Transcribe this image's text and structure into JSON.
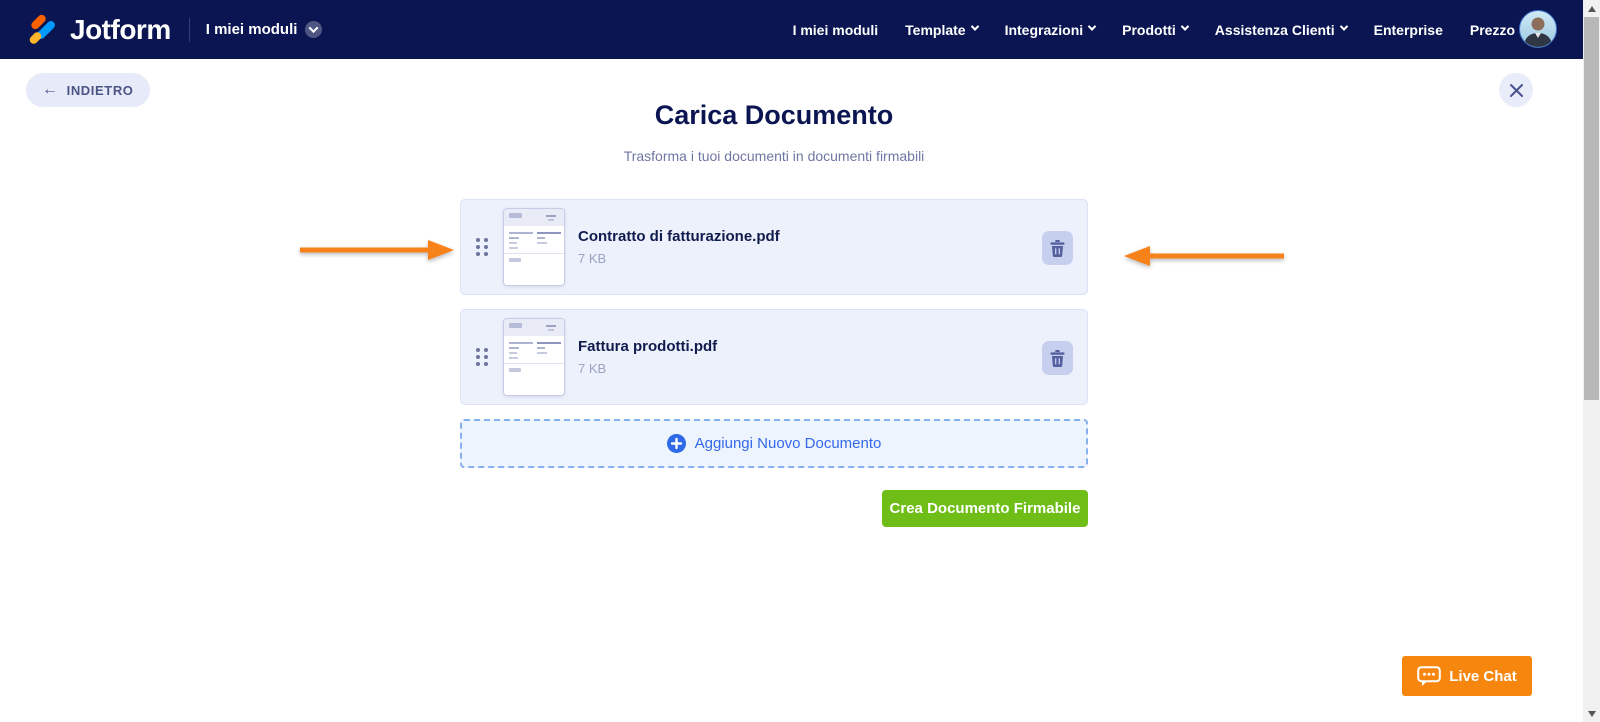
{
  "navbar": {
    "brand": "Jotform",
    "workspace_label": "I miei moduli",
    "links": [
      {
        "label": "I miei moduli",
        "dropdown": false
      },
      {
        "label": "Template",
        "dropdown": true
      },
      {
        "label": "Integrazioni",
        "dropdown": true
      },
      {
        "label": "Prodotti",
        "dropdown": true
      },
      {
        "label": "Assistenza Clienti",
        "dropdown": true
      },
      {
        "label": "Enterprise",
        "dropdown": false
      },
      {
        "label": "Prezzo",
        "dropdown": false
      }
    ]
  },
  "page": {
    "back_label": "INDIETRO",
    "title": "Carica Documento",
    "subtitle": "Trasforma i tuoi documenti in documenti firmabili"
  },
  "files": [
    {
      "name": "Contratto di fatturazione.pdf",
      "size": "7 KB"
    },
    {
      "name": "Fattura prodotti.pdf",
      "size": "7 KB"
    }
  ],
  "actions": {
    "add_new_label": "Aggiungi Nuovo Documento",
    "create_label": "Crea Documento Firmabile"
  },
  "chat": {
    "label": "Live Chat"
  },
  "colors": {
    "navbar_bg": "#0a1551",
    "accent_green": "#6fbe17",
    "accent_orange": "#f7860e",
    "link_blue": "#3568e8",
    "arrow_orange": "#f8821a",
    "card_bg": "#edf1fc"
  }
}
